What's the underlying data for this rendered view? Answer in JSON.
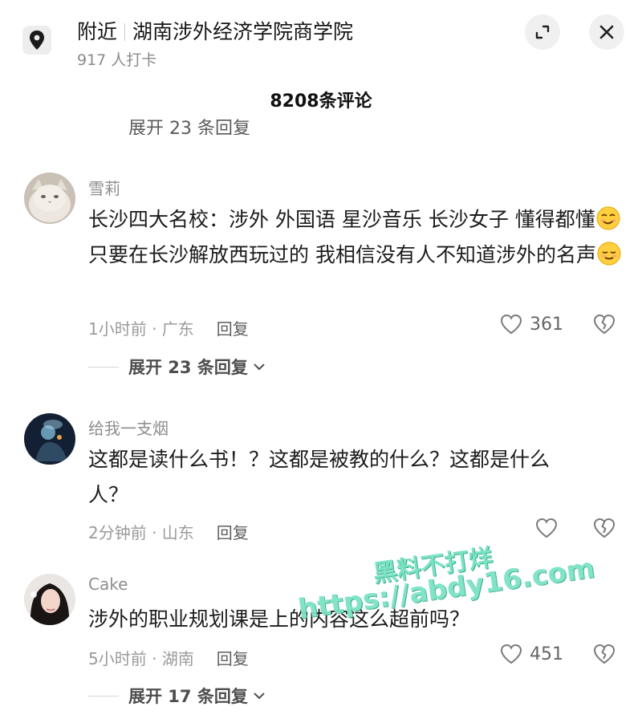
{
  "header": {
    "location_label": "附近",
    "place_name": "湖南涉外经济学院商学院",
    "checkin_text": "917 人打卡"
  },
  "comment_count_title": "8208条评论",
  "previous_thread": {
    "expand_text": "展开 23 条回复"
  },
  "comments": [
    {
      "username": "雪莉",
      "text_part1": "长沙四大名校：涉外  外国语  星沙音乐  长沙女子  懂得都懂",
      "text_part2": "只要在长沙解放西玩过的 我相信没有人不知道涉外的名声",
      "time_location": "1小时前 · 广东",
      "reply_label": "回复",
      "likes": "361",
      "expand_text": "展开 23 条回复"
    },
    {
      "username": "给我一支烟",
      "text": "这都是读什么书！？这都是被教的什么？这都是什么人？",
      "time_location": "2分钟前 · 山东",
      "reply_label": "回复"
    },
    {
      "username": "Cake",
      "text": "涉外的职业规划课是上的内容这么超前吗？",
      "time_location": "5小时前 · 湖南",
      "reply_label": "回复",
      "likes": "451",
      "expand_text": "展开 17 条回复"
    }
  ],
  "watermark": {
    "line1": "黑料不打烊",
    "line2": "https://abdy16.com"
  },
  "colors": {
    "watermark": "#7be3c3",
    "meta": "#9a9a9a",
    "username": "#8e8e8e"
  },
  "icons": [
    "location-pin-icon",
    "expand-icon",
    "close-icon",
    "heart-icon",
    "broken-heart-icon",
    "chevron-down-icon",
    "smirk-emoji-icon",
    "relieved-emoji-icon"
  ]
}
